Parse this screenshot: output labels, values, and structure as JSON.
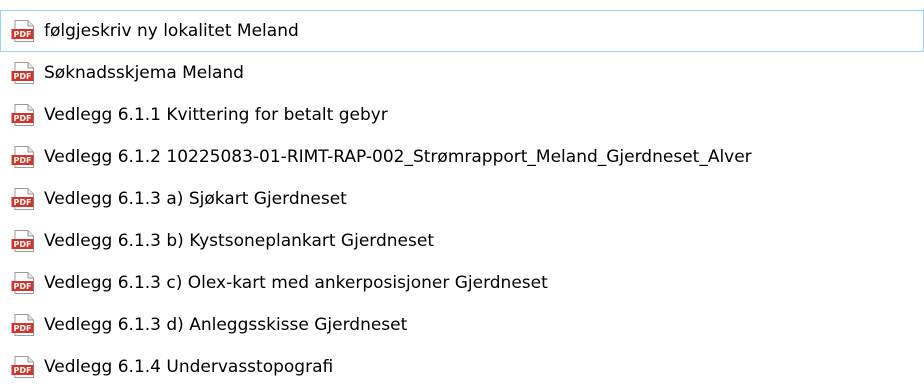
{
  "files": [
    {
      "name": "følgjeskriv ny lokalitet Meland",
      "icon": "pdf-file-icon",
      "selected": true
    },
    {
      "name": "Søknadsskjema Meland",
      "icon": "pdf-file-icon"
    },
    {
      "name": "Vedlegg 6.1.1 Kvittering for betalt gebyr",
      "icon": "pdf-file-icon"
    },
    {
      "name": "Vedlegg 6.1.2 10225083-01-RIMT-RAP-002_Strømrapport_Meland_Gjerdneset_Alver",
      "icon": "pdf-file-icon"
    },
    {
      "name": "Vedlegg 6.1.3 a) Sjøkart Gjerdneset",
      "icon": "pdf-file-icon"
    },
    {
      "name": "Vedlegg 6.1.3 b) Kystsoneplankart Gjerdneset",
      "icon": "pdf-file-icon"
    },
    {
      "name": "Vedlegg 6.1.3 c) Olex-kart med ankerposisjoner Gjerdneset",
      "icon": "pdf-file-icon"
    },
    {
      "name": "Vedlegg 6.1.3 d) Anleggsskisse Gjerdneset",
      "icon": "pdf-file-icon"
    },
    {
      "name": "Vedlegg 6.1.4 Undervasstopografi",
      "icon": "pdf-file-icon"
    }
  ],
  "icon_label": "PDF",
  "colors": {
    "pdf_red": "#d1342b",
    "selection_border": "#99d1ff"
  }
}
